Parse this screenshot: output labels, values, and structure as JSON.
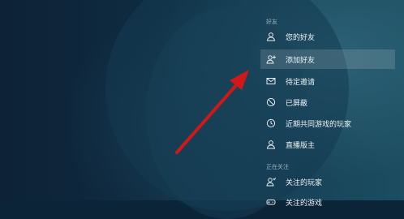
{
  "friends_section": {
    "title": "好友",
    "items": [
      {
        "label": "您的好友",
        "icon": "person-icon"
      },
      {
        "label": "添加好友",
        "icon": "add-friend-icon",
        "selected": true
      },
      {
        "label": "待定邀请",
        "icon": "envelope-icon"
      },
      {
        "label": "已屏蔽",
        "icon": "blocked-icon"
      },
      {
        "label": "近期共同游戏的玩家",
        "icon": "clock-icon"
      },
      {
        "label": "直播版主",
        "icon": "person-icon"
      }
    ]
  },
  "following_section": {
    "title": "正在关注",
    "items": [
      {
        "label": "关注的玩家",
        "icon": "followed-person-icon"
      },
      {
        "label": "关注的游戏",
        "icon": "game-icon"
      }
    ]
  },
  "colors": {
    "background_dark": "#0c2438",
    "selected_row": "rgba(255,255,255,0.14)",
    "annotation_arrow": "#d01818"
  }
}
